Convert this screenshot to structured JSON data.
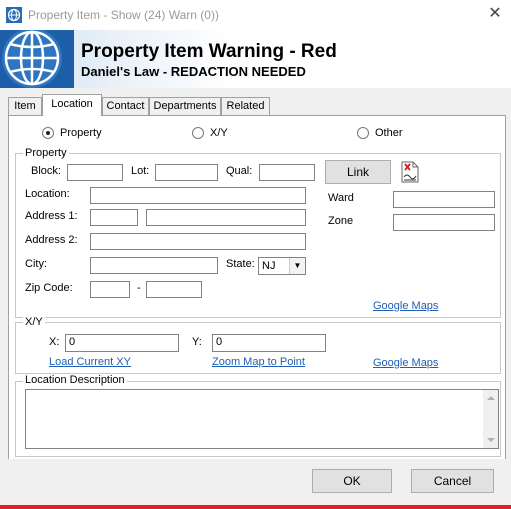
{
  "window": {
    "title": "Property Item - Show (24) Warn (0))",
    "close_glyph": "✕"
  },
  "header": {
    "title": "Property Item Warning - Red",
    "subtitle": "Daniel's Law - REDACTION NEEDED"
  },
  "tabs": [
    {
      "label": "Item"
    },
    {
      "label": "Location"
    },
    {
      "label": "Contact"
    },
    {
      "label": "Departments"
    },
    {
      "label": "Related"
    }
  ],
  "location_type": {
    "options": [
      {
        "label": "Property"
      },
      {
        "label": "X/Y"
      },
      {
        "label": "Other"
      }
    ],
    "selected": "Property"
  },
  "property": {
    "group_label": "Property",
    "block_label": "Block:",
    "block_value": "",
    "lot_label": "Lot:",
    "lot_value": "",
    "qual_label": "Qual:",
    "qual_value": "",
    "link_button": "Link",
    "location_label": "Location:",
    "location_value": "",
    "address1_label": "Address 1:",
    "address1_a": "",
    "address1_b": "",
    "address2_label": "Address 2:",
    "address2_value": "",
    "city_label": "City:",
    "city_value": "",
    "state_label": "State:",
    "state_value": "NJ",
    "zip_label": "Zip Code:",
    "zip_value": "",
    "zip_sep": "-",
    "zip_ext": "",
    "ward_label": "Ward",
    "ward_value": "",
    "zone_label": "Zone",
    "zone_value": "",
    "google_maps": "Google Maps"
  },
  "xy": {
    "group_label": "X/Y",
    "x_label": "X:",
    "x_value": "0",
    "y_label": "Y:",
    "y_value": "0",
    "load_link": "Load Current XY",
    "zoom_link": "Zoom Map to Point",
    "google_maps": "Google Maps"
  },
  "description": {
    "group_label": "Location Description",
    "value": ""
  },
  "footer": {
    "ok": "OK",
    "cancel": "Cancel"
  },
  "colors": {
    "accent_link": "#1f5fb5",
    "alert_bar": "#e02020"
  }
}
